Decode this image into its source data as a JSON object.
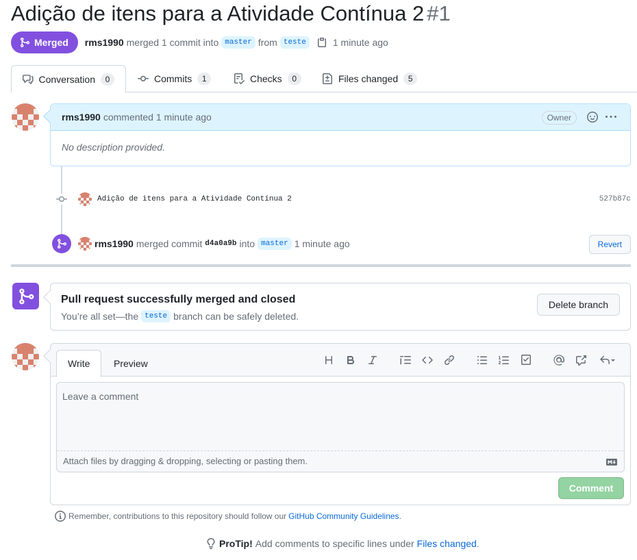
{
  "pr": {
    "title": "Adição de itens para a Atividade Contínua 2",
    "number": "#1",
    "state": "Merged",
    "author": "rms1990",
    "merged_text": "merged 1 commit into",
    "base_branch": "master",
    "from_text": "from",
    "head_branch": "teste",
    "time": "1 minute ago"
  },
  "tabs": [
    {
      "label": "Conversation",
      "count": "0"
    },
    {
      "label": "Commits",
      "count": "1"
    },
    {
      "label": "Checks",
      "count": "0"
    },
    {
      "label": "Files changed",
      "count": "5"
    }
  ],
  "comment": {
    "author": "rms1990",
    "action": "commented 1 minute ago",
    "owner_label": "Owner",
    "body": "No description provided."
  },
  "commit": {
    "message": "Adição de itens para a Atividade Contínua 2",
    "sha": "527b87c"
  },
  "merge_event": {
    "author": "rms1990",
    "text1": "merged commit",
    "sha": "d4a0a9b",
    "text2": "into",
    "branch": "master",
    "time": "1 minute ago",
    "revert_label": "Revert"
  },
  "merge_box": {
    "title": "Pull request successfully merged and closed",
    "sub_before": "You’re all set—the",
    "branch": "teste",
    "sub_after": "branch can be safely deleted.",
    "delete_label": "Delete branch"
  },
  "form": {
    "write_tab": "Write",
    "preview_tab": "Preview",
    "placeholder": "Leave a comment",
    "attach_text": "Attach files by dragging & dropping, selecting or pasting them.",
    "submit_label": "Comment"
  },
  "footnote": {
    "before": "Remember, contributions to this repository should follow our",
    "link": "GitHub Community Guidelines",
    "after": "."
  },
  "protip": {
    "label": "ProTip!",
    "before": "Add comments to specific lines under",
    "link": "Files changed",
    "after": "."
  },
  "colors": {
    "merged_purple": "#8250df",
    "link_blue": "#0969da",
    "comment_button_green": "#94d3a2"
  }
}
